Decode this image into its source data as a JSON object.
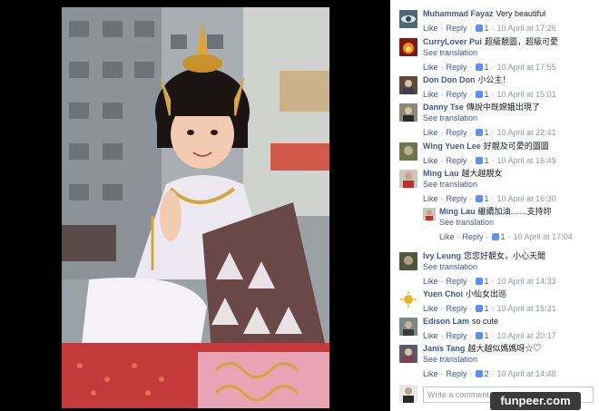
{
  "comments": [
    {
      "name": "Muhammad Fayaz",
      "text": "Very beautiful",
      "translate": "",
      "like": "Like",
      "reply": "Reply",
      "likes": "1",
      "time": "10 April at 17:26",
      "avatar": "eye-avatar"
    },
    {
      "name": "CurryLover Pui",
      "text": "超級靚圖，超級可愛",
      "translate": "See translation",
      "like": "Like",
      "reply": "Reply",
      "likes": "1",
      "time": "10 April at 17:55",
      "avatar": "fire-avatar"
    },
    {
      "name": "Don Don Don",
      "text": "小公主！",
      "translate": "",
      "like": "Like",
      "reply": "Reply",
      "likes": "1",
      "time": "10 April at 15:01",
      "avatar": "photo-avatar"
    },
    {
      "name": "Danny Tse",
      "text": "傳說中既嫦娥出現了",
      "translate": "See translation",
      "like": "Like",
      "reply": "Reply",
      "likes": "1",
      "time": "10 April at 22:41",
      "avatar": "photo-avatar"
    },
    {
      "name": "Wing Yuen Lee",
      "text": "好靚及可愛的圖圖",
      "translate": "",
      "like": "Like",
      "reply": "Reply",
      "likes": "1",
      "time": "10 April at 16:49",
      "avatar": "photo-avatar"
    },
    {
      "name": "Ming Lau",
      "text": "越大越靚女",
      "translate": "See translation",
      "like": "Like",
      "reply": "Reply",
      "likes": "1",
      "time": "10 April at 16:30",
      "avatar": "person-avatar"
    },
    {
      "name": "Ming Lau",
      "text": "繼續加油……支持妳",
      "translate": "See translation",
      "like": "Like",
      "reply": "Reply",
      "likes": "1",
      "time": "10 April at 17:04",
      "avatar": "person-avatar",
      "reply_level": true
    },
    {
      "name": "Ivy Leung",
      "text": "您您好靚女，小心天間",
      "translate": "See translation",
      "like": "Like",
      "reply": "Reply",
      "likes": "1",
      "time": "10 April at 14:33",
      "avatar": "photo-avatar"
    },
    {
      "name": "Yuen Choi",
      "text": "小仙女出巡",
      "translate": "",
      "like": "Like",
      "reply": "Reply",
      "likes": "1",
      "time": "10 April at 15:31",
      "avatar": "sun-avatar"
    },
    {
      "name": "Edison Lam",
      "text": "so cute",
      "translate": "",
      "like": "Like",
      "reply": "Reply",
      "likes": "1",
      "time": "10 April at 20:17",
      "avatar": "photo-avatar"
    },
    {
      "name": "Janis Tang",
      "text": "越大越似媽媽呀☆♡",
      "translate": "See translation",
      "like": "Like",
      "reply": "Reply",
      "likes": "2",
      "time": "10 April at 14:48",
      "avatar": "photo-avatar"
    }
  ],
  "write_placeholder": "Write a comment...",
  "watermark": "funpeer.com",
  "colors": {
    "link": "#3b5998",
    "meta": "#9197a3",
    "like": "#5890ff"
  }
}
